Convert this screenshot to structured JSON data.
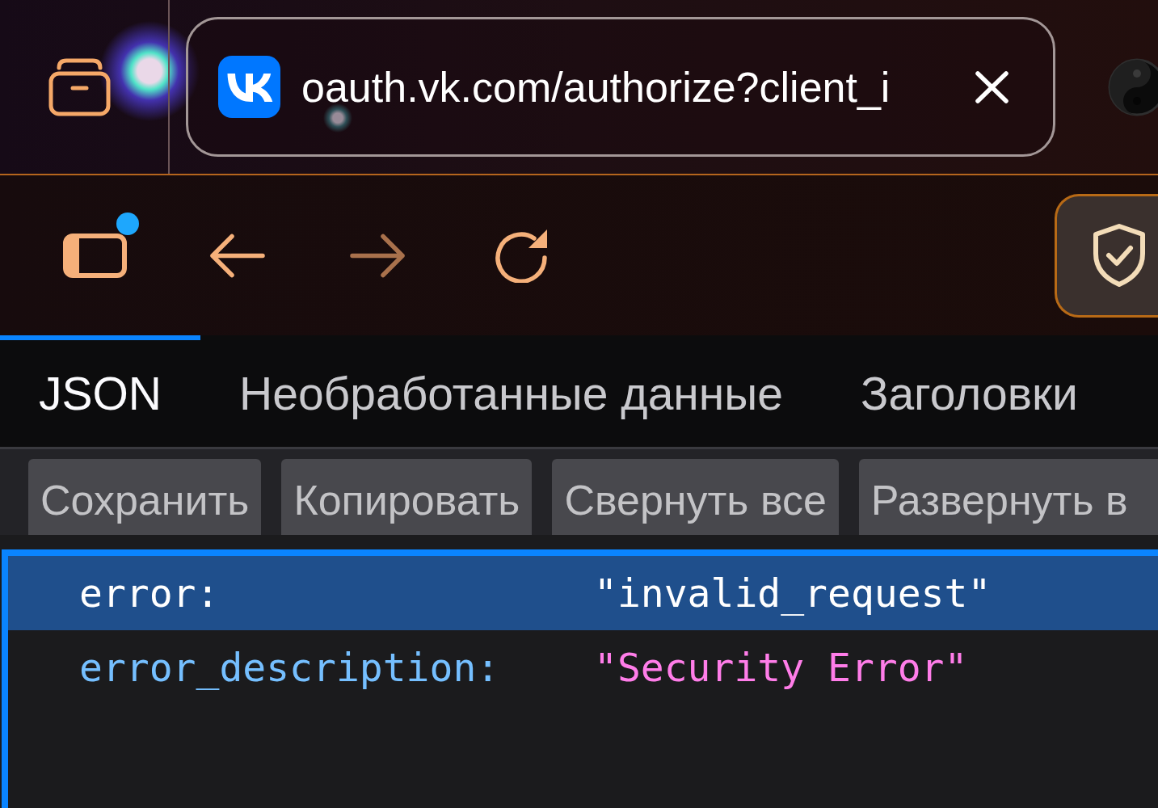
{
  "title_bar": {
    "url": "oauth.vk.com/authorize?client_i"
  },
  "nav_bar": {
    "sidebar_badge": true,
    "buttons": [
      {
        "kind": "back",
        "disabled": false
      },
      {
        "kind": "forward",
        "disabled": true
      },
      {
        "kind": "reload",
        "disabled": false
      }
    ]
  },
  "tabs": [
    {
      "label": "JSON",
      "selected": true
    },
    {
      "label": "Необработанные данные",
      "selected": false
    },
    {
      "label": "Заголовки",
      "selected": false
    }
  ],
  "toolbar": {
    "buttons": [
      "Сохранить",
      "Копировать",
      "Свернуть все",
      "Развернуть в"
    ]
  },
  "tree": {
    "focused": true,
    "rows": [
      {
        "key": "error:",
        "value": "\"invalid_request\"",
        "selected": true
      },
      {
        "key": "error_description:",
        "value": "\"Security Error\"",
        "selected": false
      }
    ]
  }
}
